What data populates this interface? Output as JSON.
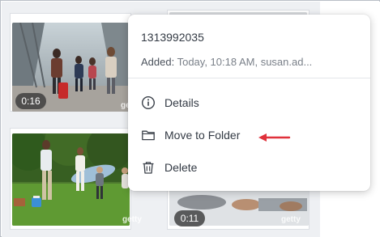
{
  "menu": {
    "asset_id": "1313992035",
    "added_label": "Added:",
    "added_value": "Today, 10:18 AM, susan.ad...",
    "items": [
      {
        "label": "Details",
        "icon": "info-icon"
      },
      {
        "label": "Move to Folder",
        "icon": "folder-icon"
      },
      {
        "label": "Delete",
        "icon": "trash-icon"
      }
    ]
  },
  "cards": [
    {
      "duration": "0:16",
      "watermark": "getty"
    },
    {
      "duration": "",
      "watermark": "getty"
    },
    {
      "duration": "0:11",
      "watermark": "getty"
    }
  ],
  "colors": {
    "annotation_arrow": "#e0313b",
    "menu_text": "#333a44",
    "muted_text": "#7a8089"
  }
}
